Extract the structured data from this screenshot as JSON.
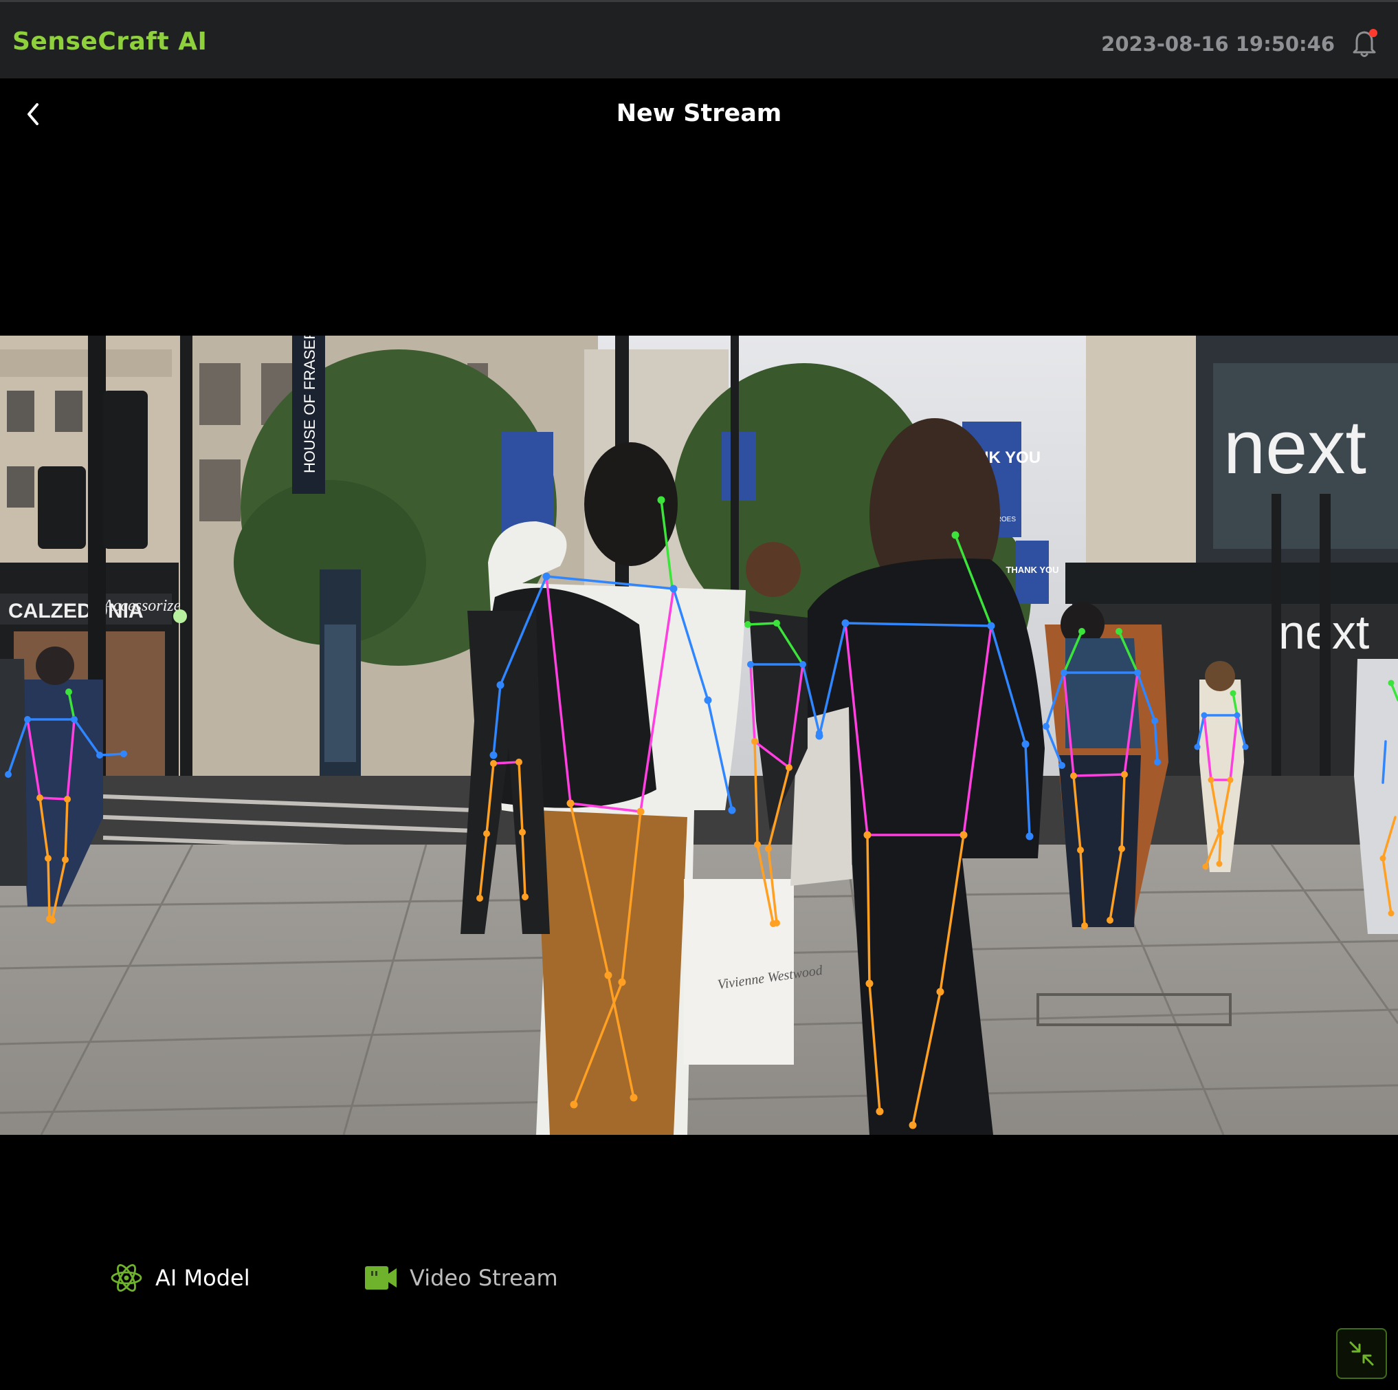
{
  "header": {
    "brand": "SenseCraft AI",
    "datetime": "2023-08-16 19:50:46",
    "bell_icon": "notification-bell-icon",
    "has_unread": true
  },
  "page": {
    "title": "New Stream",
    "back_icon": "chevron-left-icon"
  },
  "preview": {
    "overlay": "pose-skeleton",
    "signs": {
      "shop_left": "CALZEDONIA",
      "shop_left_2": "Accessorize",
      "pole_sign": "HOUSE OF FRASER",
      "banner_1": "THANK YOU",
      "banner_1_sub": "#OURHEROES",
      "banner_2": "THANK YOU",
      "shop_right": "next",
      "bag_text": "Vivienne Westwood"
    }
  },
  "tabs": [
    {
      "label": "AI Model",
      "icon": "atom-icon",
      "active": true
    },
    {
      "label": "Video Stream",
      "icon": "video-camera-icon",
      "active": false
    }
  ],
  "controls": {
    "collapse_icon": "collapse-arrows-icon"
  },
  "colors": {
    "brand": "#8fd13c",
    "accent": "#6fb32c",
    "topbar_bg": "#1f2022",
    "notify": "#ff3b30",
    "skeleton_head": "#3be33b",
    "skeleton_arms": "#2f86ff",
    "skeleton_torso": "#ff3fe0",
    "skeleton_legs": "#ffa023"
  }
}
